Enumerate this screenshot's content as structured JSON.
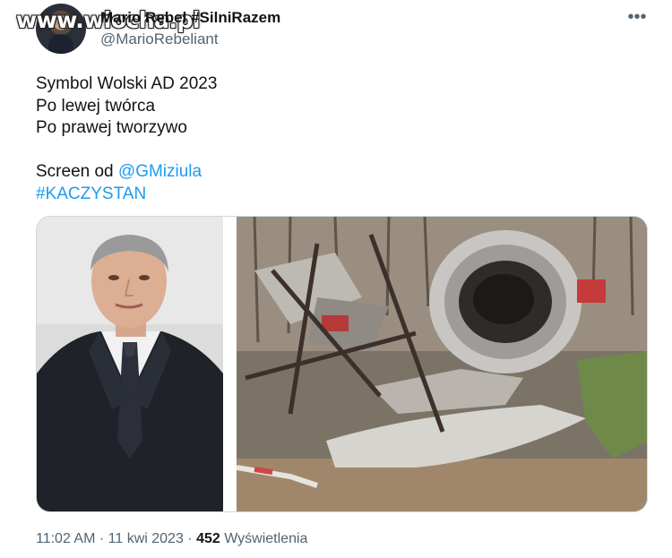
{
  "watermark": {
    "text": "www.wiocha.pl"
  },
  "author": {
    "display_name": "Mario Rebel #SilniRazem",
    "handle": "@MarioRebeliant"
  },
  "tweet": {
    "lines": [
      "Symbol Wolski AD 2023",
      "Po lewej twórca",
      "Po prawej tworzywo"
    ],
    "screen_prefix": "Screen od ",
    "mention": "@GMiziula",
    "hashtag": "#KACZYSTAN"
  },
  "meta": {
    "time": "11:02 AM",
    "separator1": " · ",
    "date": "11 kwi 2023",
    "separator2": " · ",
    "views_count": "452",
    "views_label": " Wyświetlenia"
  },
  "icons": {
    "more": "more-horizontal-icon"
  },
  "colors": {
    "link": "#1d9bf0",
    "secondary_text": "#536471",
    "primary_text": "#0f1419",
    "border": "#cfd9de"
  }
}
